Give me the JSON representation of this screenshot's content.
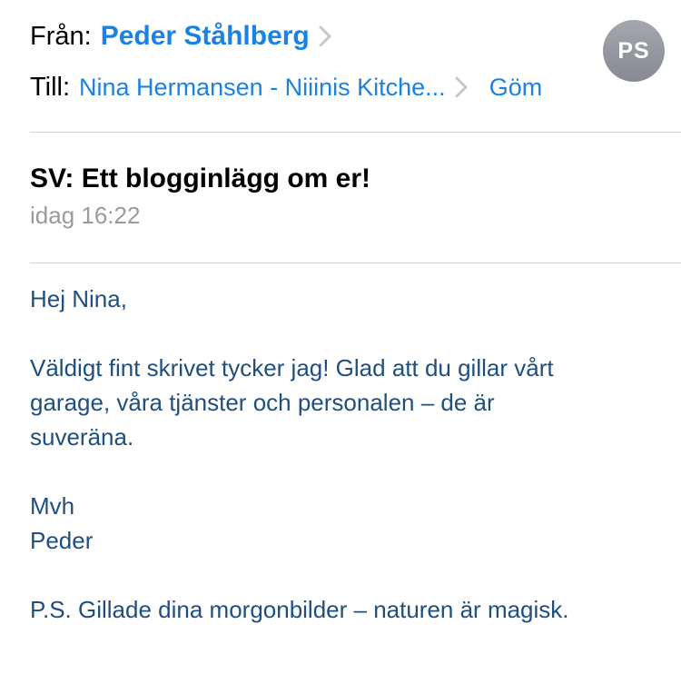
{
  "header": {
    "from_label": "Från:",
    "from_name": "Peder Ståhlberg",
    "to_label": "Till:",
    "to_name": "Nina Hermansen - Niiinis Kitche...",
    "hide_label": "Göm",
    "avatar_initials": "PS"
  },
  "message": {
    "subject": "SV: Ett blogginlägg om er!",
    "date": "idag 16:22",
    "greeting": "Hej Nina,",
    "paragraph_line1": "Väldigt fint skrivet tycker jag! Glad att du gillar vårt",
    "paragraph_line2": "garage, våra tjänster och personalen – de är",
    "paragraph_line3": "suveräna.",
    "signoff": "Mvh",
    "signature": "Peder",
    "ps": "P.S. Gillade dina morgonbilder – naturen är magisk."
  },
  "colors": {
    "link_blue": "#1a82e2",
    "body_text": "#1e4f80",
    "meta_gray": "#9b9b9f",
    "avatar_gray": "#8e9198"
  }
}
